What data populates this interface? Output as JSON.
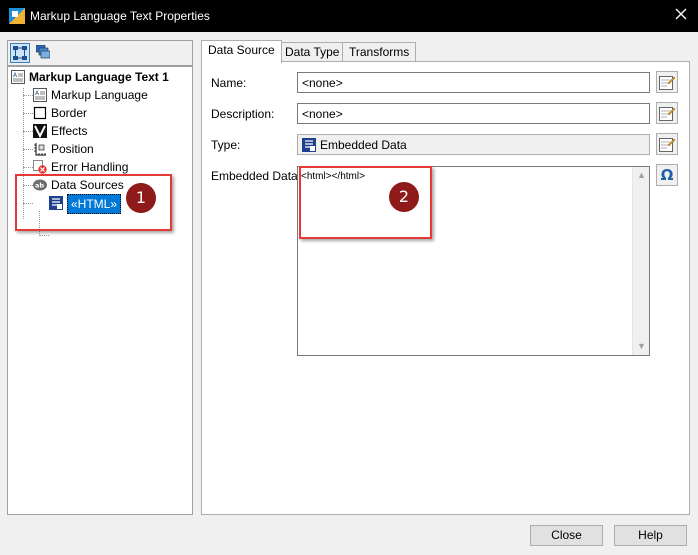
{
  "window": {
    "title": "Markup Language Text Properties"
  },
  "tree": {
    "root_label": "Markup Language Text 1",
    "items": [
      {
        "label": "Markup Language",
        "icon": "markup-language-icon"
      },
      {
        "label": "Border",
        "icon": "border-icon"
      },
      {
        "label": "Effects",
        "icon": "effects-icon"
      },
      {
        "label": "Position",
        "icon": "position-icon"
      },
      {
        "label": "Error Handling",
        "icon": "error-handling-icon"
      },
      {
        "label": "Data Sources",
        "icon": "data-sources-icon"
      }
    ],
    "child_label": "«HTML»"
  },
  "tabs": [
    {
      "label": "Data Source",
      "active": true
    },
    {
      "label": "Data Type",
      "active": false
    },
    {
      "label": "Transforms",
      "active": false
    }
  ],
  "form": {
    "name_label": "Name:",
    "name_value": "<none>",
    "description_label": "Description:",
    "description_value": "<none>",
    "type_label": "Type:",
    "type_value": "Embedded Data",
    "embedded_label": "Embedded Data:",
    "embedded_value": "<html></html>"
  },
  "annotations": {
    "badge1": "1",
    "badge2": "2"
  },
  "buttons": {
    "close": "Close",
    "help": "Help"
  },
  "colors": {
    "annotation": "#e53935",
    "badge": "#8e1a1a",
    "selection": "#0078d7"
  }
}
